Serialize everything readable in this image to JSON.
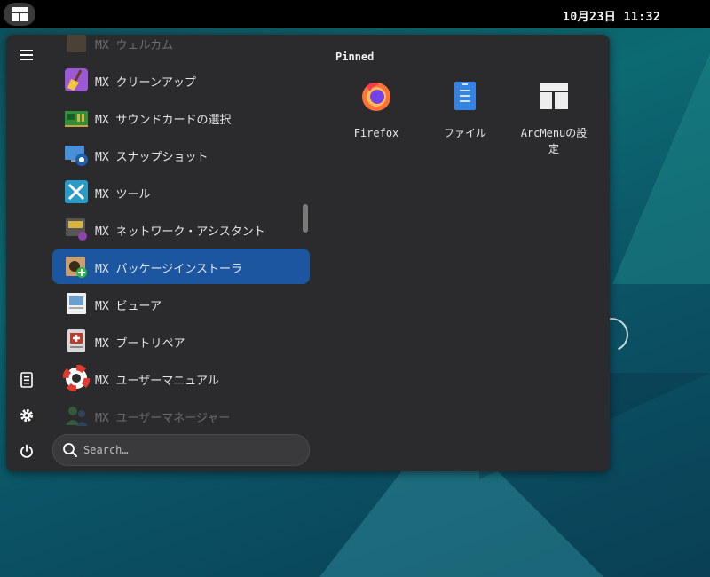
{
  "topbar": {
    "clock": "10月23日  11:32"
  },
  "menu": {
    "apps": [
      {
        "label": "MX ウェルカム",
        "icon": "box-icon"
      },
      {
        "label": "MX クリーンアップ",
        "icon": "broom-icon"
      },
      {
        "label": "MX サウンドカードの選択",
        "icon": "soundcard-icon"
      },
      {
        "label": "MX スナップショット",
        "icon": "snapshot-icon"
      },
      {
        "label": "MX ツール",
        "icon": "tools-icon"
      },
      {
        "label": "MX ネットワーク・アシスタント",
        "icon": "network-icon"
      },
      {
        "label": "MX パッケージインストーラ",
        "icon": "package-installer-icon"
      },
      {
        "label": "MX ビューア",
        "icon": "viewer-icon"
      },
      {
        "label": "MX ブートリペア",
        "icon": "boot-repair-icon"
      },
      {
        "label": "MX ユーザーマニュアル",
        "icon": "lifebuoy-icon"
      },
      {
        "label": "MX ユーザーマネージャー",
        "icon": "user-manager-icon"
      }
    ],
    "search_placeholder": "Search…",
    "pinned_title": "Pinned",
    "pinned": [
      {
        "label": "Firefox",
        "icon": "firefox-icon"
      },
      {
        "label": "ファイル",
        "icon": "files-icon"
      },
      {
        "label": "ArcMenuの設定",
        "icon": "arcmenu-icon"
      }
    ]
  },
  "colors": {
    "selected": "#1c56a0",
    "panel": "#2b2b2d"
  }
}
